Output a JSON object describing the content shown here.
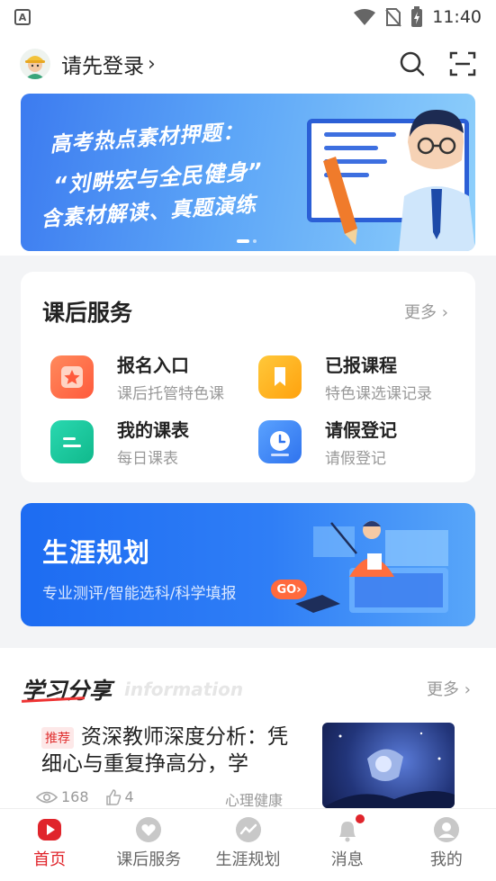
{
  "status_bar": {
    "time": "11:40",
    "app_icon_letter": "A"
  },
  "header": {
    "login_text": "请先登录",
    "chevron": "›"
  },
  "banner": {
    "line1": "高考热点素材押题：",
    "line2": "“刘畊宏与全民健身”",
    "line3": "含素材解读、真题演练",
    "active_dot": 0,
    "dot_count": 2
  },
  "services": {
    "title": "课后服务",
    "more": "更多",
    "items": [
      {
        "name": "报名入口",
        "sub": "课后托管特色课",
        "icon": "star-badge-icon",
        "color": "#ff6b4a"
      },
      {
        "name": "已报课程",
        "sub": "特色课选课记录",
        "icon": "bookmark-icon",
        "color": "#ffb21a"
      },
      {
        "name": "我的课表",
        "sub": "每日课表",
        "icon": "schedule-icon",
        "color": "#19c9a0"
      },
      {
        "name": "请假登记",
        "sub": "请假登记",
        "icon": "clock-icon",
        "color": "#3f86f7"
      }
    ]
  },
  "career": {
    "title": "生涯规划",
    "subtitle": "专业测评/智能选科/科学填报",
    "go": "GO"
  },
  "share": {
    "title": "学习分享",
    "title_en": "information",
    "more": "更多",
    "article": {
      "tag": "推荐",
      "title": "资深教师深度分析：凭细心与重复挣高分，学",
      "views": "168",
      "likes": "4",
      "category": "心理健康"
    }
  },
  "bottom_nav": [
    {
      "label": "首页",
      "icon": "home-play-icon",
      "active": true
    },
    {
      "label": "课后服务",
      "icon": "heart-icon",
      "active": false
    },
    {
      "label": "生涯规划",
      "icon": "trend-icon",
      "active": false
    },
    {
      "label": "消息",
      "icon": "bell-icon",
      "active": false,
      "badge": true
    },
    {
      "label": "我的",
      "icon": "profile-icon",
      "active": false
    }
  ],
  "colors": {
    "accent": "#e0242b",
    "career_blue": "#1d6cf2"
  }
}
